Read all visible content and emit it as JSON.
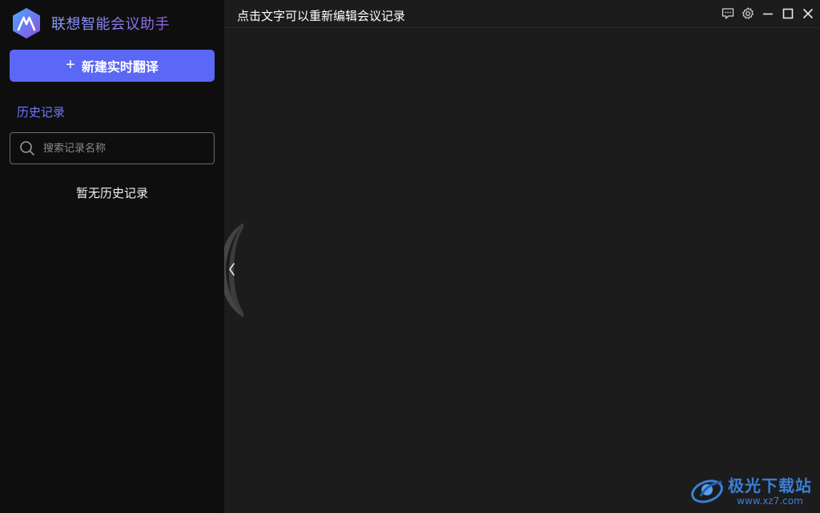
{
  "app": {
    "title": "联想智能会议助手"
  },
  "sidebar": {
    "new_button_label": "新建实时翻译",
    "history_title": "历史记录",
    "search_placeholder": "搜索记录名称",
    "search_value": "",
    "empty_text": "暂无历史记录"
  },
  "main": {
    "title": "点击文字可以重新编辑会议记录"
  },
  "icons": {
    "feedback": "feedback-icon",
    "settings": "gear-icon",
    "minimize": "minimize-icon",
    "maximize": "maximize-icon",
    "close": "close-icon",
    "collapse": "chevron-left-icon",
    "search": "search-icon"
  },
  "watermark": {
    "name": "极光下载站",
    "url": "www.xz7.com"
  },
  "colors": {
    "accent": "#5b67f5",
    "sidebar_bg": "#0e0e0e",
    "main_bg": "#1c1c1c",
    "history_title": "#6e78ff"
  }
}
